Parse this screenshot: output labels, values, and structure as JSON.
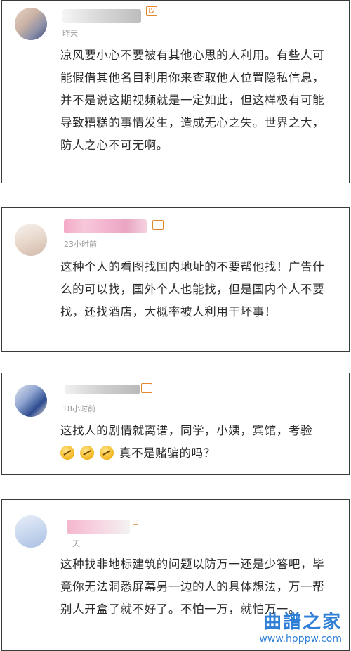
{
  "comments": [
    {
      "time": "昨天",
      "badge": "LV",
      "text": "凉风要小心不要被有其他心思的人利用。有些人可能假借其他名目利用你来查取他人位置隐私信息，并不是说这期视频就是一定如此，但这样极有可能导致糟糕的事情发生，造成无心之失。世界之大，防人之心不可无啊。"
    },
    {
      "time": "23小时前",
      "text": "这种个人的看图找国内地址的不要帮他找！广告什么的可以找，国外个人也能找，但是国内个人不要找，还找酒店，大概率被人利用干坏事！"
    },
    {
      "time": "18小时前",
      "text_before": "这找人的剧情就离谱，同学，小姨，宾馆，考验",
      "text_after": "真不是赌骗的吗？",
      "emoji_icons": [
        "laugh-cry-icon",
        "laugh-cry-icon",
        "laugh-cry-icon"
      ]
    },
    {
      "time": "天",
      "text": "这种找非地标建筑的问题以防万一还是少答吧，毕竟你无法洞悉屏幕另一边的人的具体想法，万一帮别人开盒了就不好了。不怕一万，就怕万一。"
    }
  ],
  "watermark": {
    "title": "曲譜之家",
    "url": "www.hpppw.com"
  }
}
